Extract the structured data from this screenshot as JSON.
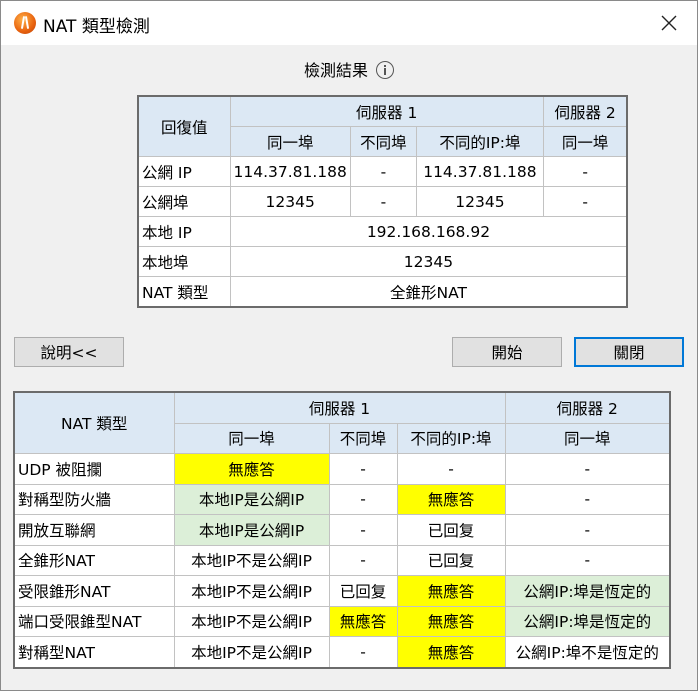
{
  "window": {
    "title": "NAT 類型檢測",
    "close_symbol": "✕"
  },
  "results": {
    "title": "檢測結果",
    "headers": {
      "response": "回復值",
      "server1": "伺服器 1",
      "server2": "伺服器 2",
      "same_port": "同一埠",
      "diff_port": "不同埠",
      "diff_ip_port": "不同的IP:埠",
      "same_port_2": "同一埠"
    },
    "rows": {
      "public_ip": {
        "label": "公網 IP",
        "s1_same": "114.37.81.188",
        "s1_diff_port": "-",
        "s1_diff_ip": "114.37.81.188",
        "s2_same": "-"
      },
      "public_port": {
        "label": "公網埠",
        "s1_same": "12345",
        "s1_diff_port": "-",
        "s1_diff_ip": "12345",
        "s2_same": "-"
      },
      "local_ip": {
        "label": "本地 IP",
        "value": "192.168.168.92"
      },
      "local_port": {
        "label": "本地埠",
        "value": "12345"
      },
      "nat_type": {
        "label": "NAT 類型",
        "value": "全錐形NAT"
      }
    }
  },
  "buttons": {
    "explain": "說明<<",
    "start": "開始",
    "close": "關閉"
  },
  "reference": {
    "headers": {
      "nat_type": "NAT 類型",
      "server1": "伺服器 1",
      "server2": "伺服器 2",
      "same_port": "同一埠",
      "diff_port": "不同埠",
      "diff_ip_port": "不同的IP:埠",
      "same_port_2": "同一埠"
    },
    "rows": [
      {
        "name": "UDP 被阻攔",
        "c1": "無應答",
        "c2": "-",
        "c3": "-",
        "c4": "-"
      },
      {
        "name": "對稱型防火牆",
        "c1": "本地IP是公網IP",
        "c2": "-",
        "c3": "無應答",
        "c4": "-"
      },
      {
        "name": "開放互聯網",
        "c1": "本地IP是公網IP",
        "c2": "-",
        "c3": "已回复",
        "c4": "-"
      },
      {
        "name": "全錐形NAT",
        "c1": "本地IP不是公網IP",
        "c2": "-",
        "c3": "已回复",
        "c4": "-"
      },
      {
        "name": "受限錐形NAT",
        "c1": "本地IP不是公網IP",
        "c2": "已回复",
        "c3": "無應答",
        "c4": "公網IP:埠是恆定的"
      },
      {
        "name": "端口受限錐型NAT",
        "c1": "本地IP不是公網IP",
        "c2": "無應答",
        "c3": "無應答",
        "c4": "公網IP:埠是恆定的"
      },
      {
        "name": "對稱型NAT",
        "c1": "本地IP不是公網IP",
        "c2": "-",
        "c3": "無應答",
        "c4": "公網IP:埠不是恆定的"
      }
    ]
  },
  "colors": {
    "header_bg": "#dce8f4",
    "no_response": "#ffff00",
    "public_ip_green": "#dcefd8",
    "focus_border": "#0078d7"
  }
}
